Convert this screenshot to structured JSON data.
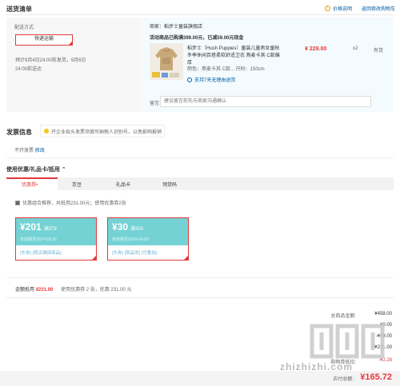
{
  "header": {
    "title": "送货清单",
    "price_note": "价格说明",
    "return_link": "返回修改购物车"
  },
  "shipping": {
    "label": "配送方式",
    "method": "快递运输",
    "schedule": "预计9月4日24:00前发货，9月6日24:00前送达"
  },
  "product": {
    "shop": "商家：稻步士童装旗舰店",
    "promo": "活动商品已购满399.00元，已减59.00元现金",
    "name": "稻步士（Hush Puppies）童装儿童男女童秋冬季休闲百搭柔软舒适卫衣 燕麦卡其 C款偏厚",
    "attr": "颜色：燕麦卡其 C款...  尺码：150cm",
    "support": "支持7天无理由退货",
    "price": "¥ 229.00",
    "qty": "x2",
    "stock": "有货"
  },
  "remark": {
    "label": "留言:",
    "placeholder": "建议留言前先与商家沟通确认"
  },
  "invoice": {
    "title": "发票信息",
    "notice": "开企业抬头发票须填写纳税人识别号，以免影响报销",
    "type": "不开发票",
    "edit": "修改"
  },
  "coupons": {
    "title": "使用优惠/礼品卡/抵用",
    "tabs": [
      {
        "label": "优惠券"
      },
      {
        "label": "京豆"
      },
      {
        "label": "礼品卡"
      },
      {
        "label": "领货码"
      }
    ],
    "combo_text": "优惠组合推荐，共抵用231.00元；使用优惠券2张",
    "cards": [
      {
        "amount": "¥201",
        "cond": "满379",
        "date": "有效期至2024-09-30",
        "tags": "[东券] [限店铺部商品]"
      },
      {
        "amount": "¥30",
        "cond": "满300",
        "date": "有效期至2024-09-03",
        "tags": "[东券] [限品类] [可叠加]"
      }
    ],
    "discount_label": "金额抵用",
    "discount_amount": "¥231.00",
    "discount_note": "使用优惠券 2 张，优惠 231.00 元"
  },
  "totals": {
    "rows": [
      {
        "label": "总商品金额:",
        "value": "¥458.00"
      },
      {
        "label": "",
        "value": "¥0.00"
      },
      {
        "label": "",
        "value": "-¥59.00"
      },
      {
        "label": "",
        "value": "¥0.00"
      },
      {
        "label": "",
        "value": "-¥231.00"
      },
      {
        "label": "",
        "value": "¥0.00"
      },
      {
        "label": "购物券抵扣:",
        "value": "-¥2.28"
      }
    ],
    "pay_label": "应付总额:",
    "pay_amount": "¥165.72"
  },
  "watermark": {
    "text": "zhizhizhi.com"
  },
  "colors": {
    "accent": "#e4393c",
    "link": "#005aa0",
    "coupon": "#74d2d4"
  }
}
